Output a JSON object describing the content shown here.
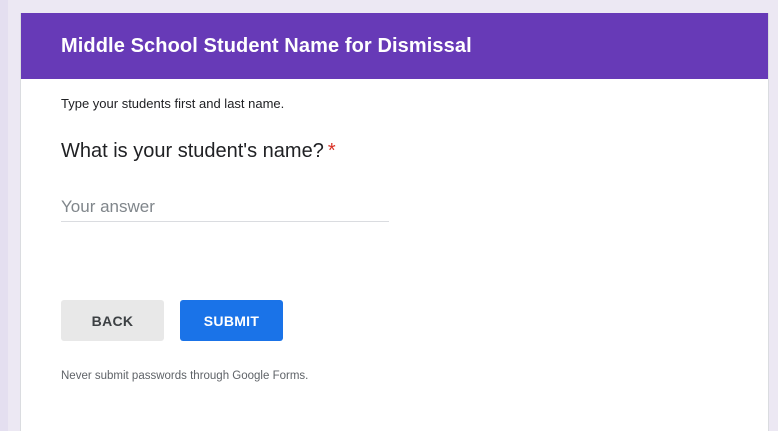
{
  "form": {
    "title": "Middle School Student Name for Dismissal",
    "section_description": "Type your students first and last name.",
    "question": {
      "text": "What is your student's name?",
      "required_marker": "*",
      "placeholder": "Your answer",
      "value": ""
    },
    "buttons": {
      "back_label": "BACK",
      "submit_label": "SUBMIT"
    },
    "footer_note": "Never submit passwords through Google Forms."
  },
  "colors": {
    "header": "#673ab7",
    "submit": "#1a73e8",
    "required": "#d93025"
  }
}
